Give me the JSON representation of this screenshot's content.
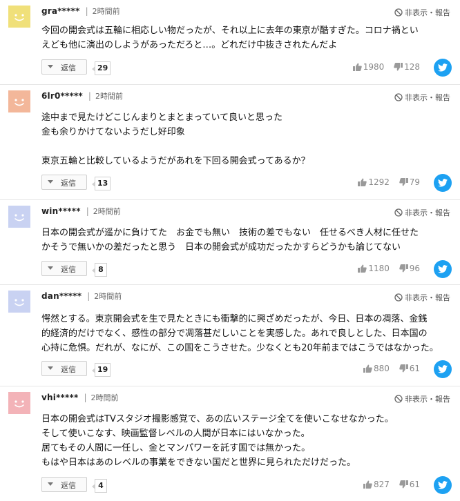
{
  "ui": {
    "time_sep": "|",
    "report_label": "非表示・報告",
    "reply_label": "返信"
  },
  "comments": [
    {
      "user": "gra*****",
      "time": "2時間前",
      "avatar_color": "#f0e07a",
      "text": "今回の開会式は五輪に相応しい物だったが、それ以上に去年の東京が酷すぎた。コロナ禍とい\nえども他に演出のしようがあっただろと…。どれだけ中抜きされたんだよ",
      "replies": "29",
      "likes": "1980",
      "dislikes": "128"
    },
    {
      "user": "6lr0*****",
      "time": "2時間前",
      "avatar_color": "#f3b79a",
      "text": "途中まで見たけどこじんまりとまとまっていて良いと思った\n金も余りかけてないようだし好印象\n\n東京五輪と比較しているようだがあれを下回る開会式ってあるか？",
      "replies": "13",
      "likes": "1292",
      "dislikes": "79"
    },
    {
      "user": "win*****",
      "time": "2時間前",
      "avatar_color": "#c9d2f2",
      "text": "日本の開会式が遥かに負けてた　お金でも無い　技術の差でもない　任せるべき人材に任せた\nかそうで無いかの差だったと思う　日本の開会式が成功だったかすらどうかも論じてない",
      "replies": "8",
      "likes": "1180",
      "dislikes": "96"
    },
    {
      "user": "dan*****",
      "time": "2時間前",
      "avatar_color": "#c9d2f2",
      "text": "愕然とする。東京開会式を生で見たときにも衝撃的に興ざめだったが、今日、日本の凋落、金銭\n的経済的だけでなく、感性の部分で凋落甚だしいことを実感した。あれで良しとした、日本国の\n心持に危惧。だれが、なにが、この国をこうさせた。少なくとも20年前まではこうではなかった。",
      "replies": "19",
      "likes": "880",
      "dislikes": "61"
    },
    {
      "user": "vhi*****",
      "time": "2時間前",
      "avatar_color": "#f3b3b8",
      "text": "日本の開会式はTVスタジオ撮影感覚で、あの広いステージ全てを使いこなせなかった。\nそして使いこなす、映画監督レベルの人間が日本にはいなかった。\n居てもその人間に一任し、金とマンパワーを託す国では無かった。\nもはや日本はあのレベルの事業をできない国だと世界に見られただけだった。",
      "replies": "4",
      "likes": "827",
      "dislikes": "61"
    }
  ]
}
